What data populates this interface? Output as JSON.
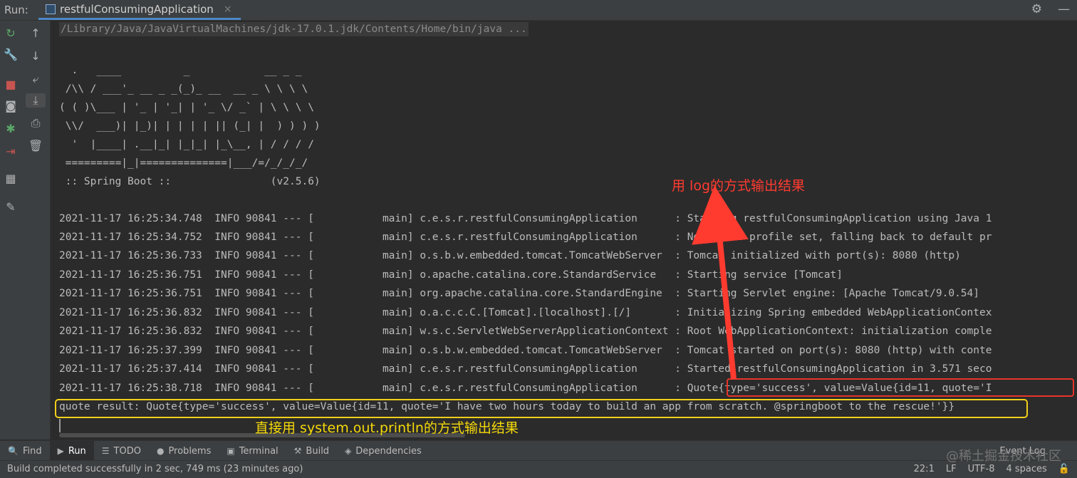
{
  "header": {
    "run_label": "Run:",
    "tab_title": "restfulConsumingApplication",
    "tab_close": "×",
    "settings_icon": "⚙",
    "minimize_icon": "—"
  },
  "console": {
    "command": "/Library/Java/JavaVirtualMachines/jdk-17.0.1.jdk/Contents/Home/bin/java ...",
    "banner": [
      "  .   ____          _            __ _ _",
      " /\\\\ / ___'_ __ _ _(_)_ __  __ _ \\ \\ \\ \\",
      "( ( )\\___ | '_ | '_| | '_ \\/ _` | \\ \\ \\ \\",
      " \\\\/  ___)| |_)| | | | | || (_| |  ) ) ) )",
      "  '  |____| .__|_| |_|_| |_\\__, | / / / /",
      " =========|_|==============|___/=/_/_/_/",
      " :: Spring Boot ::                (v2.5.6)"
    ],
    "logs": [
      "2021-11-17 16:25:34.748  INFO 90841 --- [           main] c.e.s.r.restfulConsumingApplication      : Starting restfulConsumingApplication using Java 1",
      "2021-11-17 16:25:34.752  INFO 90841 --- [           main] c.e.s.r.restfulConsumingApplication      : No active profile set, falling back to default pr",
      "2021-11-17 16:25:36.733  INFO 90841 --- [           main] o.s.b.w.embedded.tomcat.TomcatWebServer  : Tomcat initialized with port(s): 8080 (http)",
      "2021-11-17 16:25:36.751  INFO 90841 --- [           main] o.apache.catalina.core.StandardService   : Starting service [Tomcat]",
      "2021-11-17 16:25:36.751  INFO 90841 --- [           main] org.apache.catalina.core.StandardEngine  : Starting Servlet engine: [Apache Tomcat/9.0.54]",
      "2021-11-17 16:25:36.832  INFO 90841 --- [           main] o.a.c.c.C.[Tomcat].[localhost].[/]       : Initializing Spring embedded WebApplicationContex",
      "2021-11-17 16:25:36.832  INFO 90841 --- [           main] w.s.c.ServletWebServerApplicationContext : Root WebApplicationContext: initialization comple",
      "2021-11-17 16:25:37.399  INFO 90841 --- [           main] o.s.b.w.embedded.tomcat.TomcatWebServer  : Tomcat started on port(s): 8080 (http) with conte",
      "2021-11-17 16:25:37.414  INFO 90841 --- [           main] c.e.s.r.restfulConsumingApplication      : Started restfulConsumingApplication in 3.571 seco",
      "2021-11-17 16:25:38.718  INFO 90841 --- [           main] c.e.s.r.restfulConsumingApplication      : Quote{type='success', value=Value{id=11, quote='I"
    ],
    "println_line": "quote result: Quote{type='success', value=Value{id=11, quote='I have two hours today to build an app from scratch. @springboot to the rescue!'}}"
  },
  "annotations": {
    "log_note": "用 log的方式输出结果",
    "println_note": "直接用 system.out.println的方式输出结果",
    "log_color": "#ff3b30",
    "println_color": "#f5d90a"
  },
  "toolbar": {
    "find": "Find",
    "run": "Run",
    "todo": "TODO",
    "problems": "Problems",
    "terminal": "Terminal",
    "build": "Build",
    "dependencies": "Dependencies",
    "event_log": "Event Log"
  },
  "status": {
    "message": "Build completed successfully in 2 sec, 749 ms (23 minutes ago)",
    "position": "22:1",
    "line_sep": "LF",
    "encoding": "UTF-8",
    "indent": "4 spaces"
  },
  "watermark": "@稀土掘金技术社区"
}
